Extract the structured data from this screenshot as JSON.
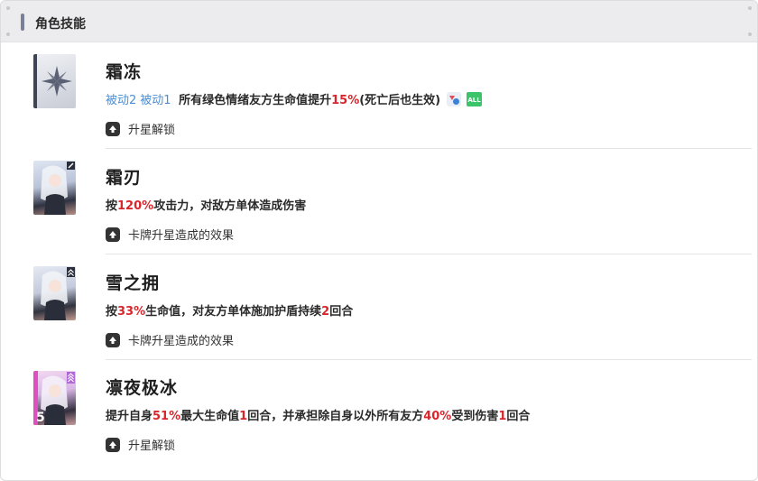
{
  "header": {
    "title": "角色技能"
  },
  "skills": [
    {
      "name": "霜冻",
      "passive_tags": [
        "被动2",
        "被动1"
      ],
      "desc": [
        {
          "t": "所有绿色情绪友方生命值提升"
        },
        {
          "t": "15%",
          "hl": true
        },
        {
          "t": "(死亡后也生效)"
        }
      ],
      "badge_all": "ALL",
      "unlock": "升星解锁"
    },
    {
      "name": "霜刃",
      "desc": [
        {
          "t": "按"
        },
        {
          "t": "120%",
          "hl": true
        },
        {
          "t": "攻击力，对敌方单体造成伤害"
        }
      ],
      "unlock": "卡牌升星造成的效果"
    },
    {
      "name": "雪之拥",
      "desc": [
        {
          "t": "按"
        },
        {
          "t": "33%",
          "hl": true
        },
        {
          "t": "生命值，对友方单体施加护盾持续"
        },
        {
          "t": "2",
          "hl": true
        },
        {
          "t": "回合"
        }
      ],
      "unlock": "卡牌升星造成的效果"
    },
    {
      "name": "凛夜极冰",
      "desc": [
        {
          "t": "提升自身"
        },
        {
          "t": "51%",
          "hl": true
        },
        {
          "t": "最大生命值"
        },
        {
          "t": "1",
          "hl": true
        },
        {
          "t": "回合，并承担除自身以外所有友方"
        },
        {
          "t": "40%",
          "hl": true
        },
        {
          "t": "受到伤害"
        },
        {
          "t": "1",
          "hl": true
        },
        {
          "t": "回合"
        }
      ],
      "unlock": "升星解锁"
    }
  ],
  "colors": {
    "highlight": "#d8262c",
    "passive_tag": "#4a8fd6",
    "header_bg": "#ececee",
    "badge_all": "#3cc46a"
  }
}
